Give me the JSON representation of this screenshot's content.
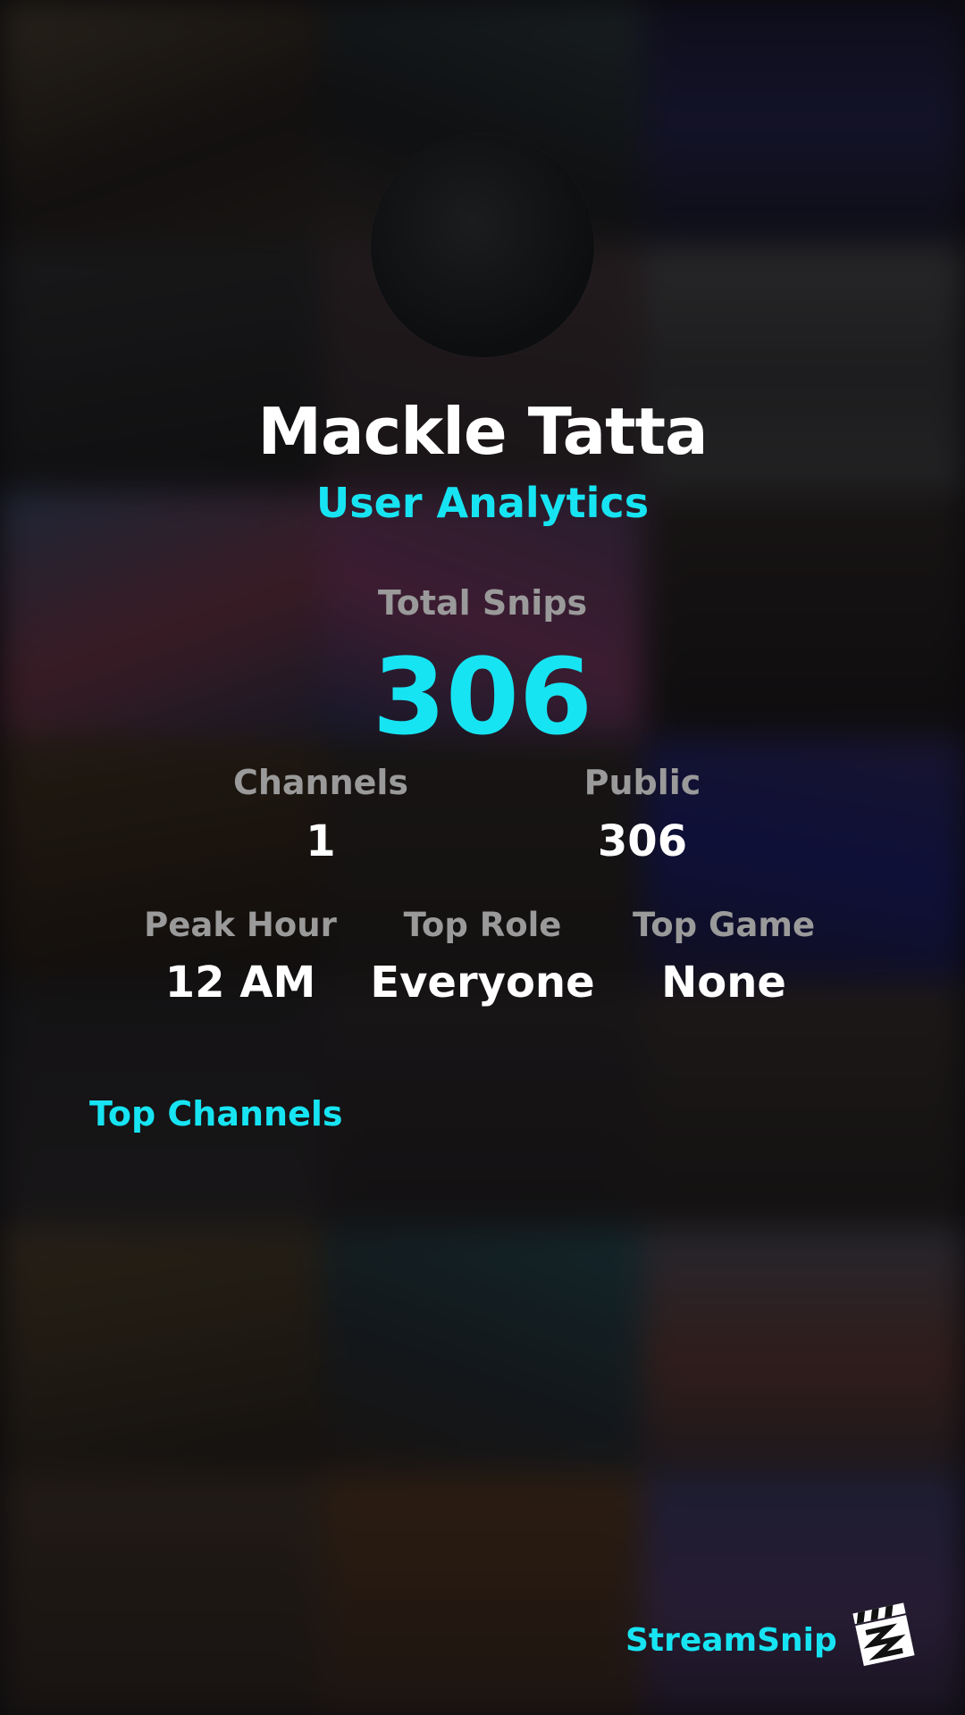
{
  "profile": {
    "name": "Mackle Tatta",
    "subtitle": "User Analytics",
    "avatar_icon": "avatar-image"
  },
  "stats": {
    "total_snips_label": "Total Snips",
    "total_snips_value": "306",
    "channels_label": "Channels",
    "channels_value": "1",
    "public_label": "Public",
    "public_value": "306",
    "peak_hour_label": "Peak Hour",
    "peak_hour_value": "12 AM",
    "top_role_label": "Top Role",
    "top_role_value": "Everyone",
    "top_game_label": "Top Game",
    "top_game_value": "None"
  },
  "sections": {
    "top_channels_title": "Top Channels"
  },
  "brand": {
    "name": "StreamSnip",
    "logo_icon": "clapperboard-icon"
  },
  "colors": {
    "accent": "#17e4f2",
    "label_gray": "#9a9a9a",
    "value_white": "#ffffff"
  }
}
